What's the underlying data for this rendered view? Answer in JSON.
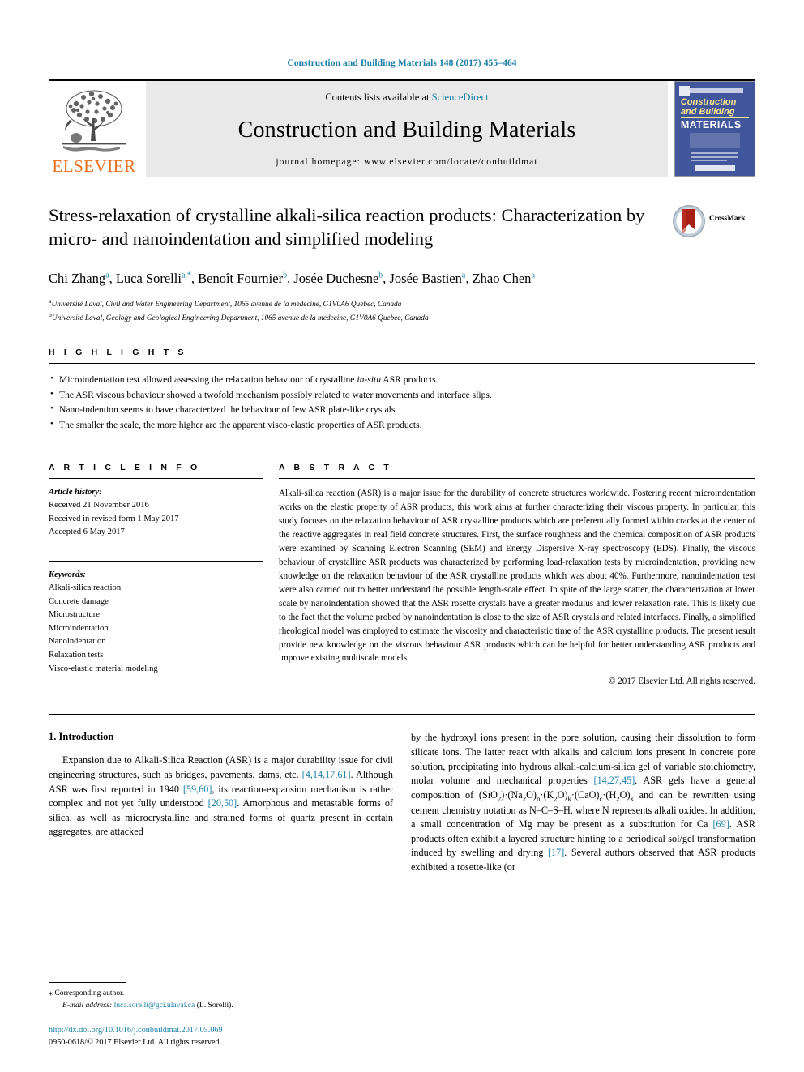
{
  "running_head": "Construction and Building Materials 148 (2017) 455–464",
  "masthead": {
    "publisher": "ELSEVIER",
    "contents_prefix": "Contents lists available at ",
    "contents_link": "ScienceDirect",
    "journal_title": "Construction and Building Materials",
    "homepage": "journal homepage: www.elsevier.com/locate/conbuildmat",
    "cover": {
      "line1": "Construction",
      "line2": "and Building",
      "line3": "MATERIALS"
    }
  },
  "article": {
    "title": "Stress-relaxation of crystalline alkali-silica reaction products: Characterization by micro- and nanoindentation and simplified modeling",
    "crossmark_label": "CrossMark",
    "authors": [
      {
        "name": "Chi Zhang",
        "sup": "a"
      },
      {
        "name": "Luca Sorelli",
        "sup": "a,*"
      },
      {
        "name": "Benoît Fournier",
        "sup": "b"
      },
      {
        "name": "Josée Duchesne",
        "sup": "b"
      },
      {
        "name": "Josée Bastien",
        "sup": "a"
      },
      {
        "name": "Zhao Chen",
        "sup": "a"
      }
    ],
    "affiliations": [
      {
        "sup": "a",
        "text": "Université Laval, Civil and Water Engineering Department, 1065 avenue de la medecine, G1V0A6 Quebec, Canada"
      },
      {
        "sup": "b",
        "text": "Université Laval, Geology and Geological Engineering Department, 1065 avenue de la medecine, G1V0A6 Quebec, Canada"
      }
    ]
  },
  "highlights": {
    "heading": "H I G H L I G H T S",
    "items": [
      "Microindentation test allowed assessing the relaxation behaviour of crystalline in-situ ASR products.",
      "The ASR viscous behaviour showed a twofold mechanism possibly related to water movements and interface slips.",
      "Nano-indention seems to have characterized the behaviour of few ASR plate-like crystals.",
      "The smaller the scale, the more higher are the apparent visco-elastic properties of ASR products."
    ]
  },
  "article_info": {
    "heading": "A R T I C L E    I N F O",
    "history_label": "Article history:",
    "history": [
      "Received 21 November 2016",
      "Received in revised form 1 May 2017",
      "Accepted 6 May 2017"
    ],
    "keywords_label": "Keywords:",
    "keywords": [
      "Alkali-silica reaction",
      "Concrete damage",
      "Microstructure",
      "Microindentation",
      "Nanoindentation",
      "Relaxation tests",
      "Visco-elastic material modeling"
    ]
  },
  "abstract": {
    "heading": "A B S T R A C T",
    "text": "Alkali-silica reaction (ASR) is a major issue for the durability of concrete structures worldwide. Fostering recent microindentation works on the elastic property of ASR products, this work aims at further characterizing their viscous property. In particular, this study focuses on the relaxation behaviour of ASR crystalline products which are preferentially formed within cracks at the center of the reactive aggregates in real field concrete structures. First, the surface roughness and the chemical composition of ASR products were examined by Scanning Electron Scanning (SEM) and Energy Dispersive X-ray spectroscopy (EDS). Finally, the viscous behaviour of crystalline ASR products was characterized by performing load-relaxation tests by microindentation, providing new knowledge on the relaxation behaviour of the ASR crystalline products which was about 40%. Furthermore, nanoindentation test were also carried out to better understand the possible length-scale effect. In spite of the large scatter, the characterization at lower scale by nanoindentation showed that the ASR rosette crystals have a greater modulus and lower relaxation rate. This is likely due to the fact that the volume probed by nanoindentation is close to the size of ASR crystals and related interfaces. Finally, a simplified rheological model was employed to estimate the viscosity and characteristic time of the ASR crystalline products. The present result provide new knowledge on the viscous behaviour ASR products which can be helpful for better understanding ASR products and improve existing multiscale models.",
    "copyright": "© 2017 Elsevier Ltd. All rights reserved."
  },
  "introduction": {
    "heading": "1. Introduction",
    "left_paragraph_parts": [
      "Expansion due to Alkali-Silica Reaction (ASR) is a major durability issue for civil engineering structures, such as bridges, pavements, dams, etc. ",
      "[4,14,17,61]",
      ". Although ASR was first reported in 1940 ",
      "[59,60]",
      ", its reaction-expansion mechanism is rather complex and not yet fully understood ",
      "[20,50]",
      ". Amorphous and metastable forms of silica, as well as microcrystalline and strained forms of quartz present in certain aggregates, are attacked"
    ],
    "right_paragraph_parts": [
      "by the hydroxyl ions present in the pore solution, causing their dissolution to form silicate ions. The latter react with alkalis and calcium ions present in concrete pore solution, precipitating into hydrous alkali-calcium-silica gel of variable stoichiometry, molar volume and mechanical properties ",
      "[14,27,45]",
      ". ASR gels have a general composition of (SiO2)·(Na2O)n·(K2O)k·(CaO)c·(H2O)x and can be rewritten using cement chemistry notation as N–C–S–H, where N represents alkali oxides. In addition, a small concentration of Mg may be present as a substitution for Ca ",
      "[69]",
      ". ASR products often exhibit a layered structure hinting to a periodical sol/gel transformation induced by swelling and drying ",
      "[17]",
      ". Several authors observed that ASR products exhibited a rosette-like (or"
    ]
  },
  "footer": {
    "corresponding_star": "⁎",
    "corresponding_label": "Corresponding author.",
    "email_label": "E-mail address:",
    "email": "luca.sorelli@gci.ulaval.ca",
    "email_suffix": "(L. Sorelli).",
    "doi": "http://dx.doi.org/10.1016/j.conbuildmat.2017.05.069",
    "issn_line": "0950-0618/© 2017 Elsevier Ltd. All rights reserved."
  },
  "colors": {
    "link": "#1a7fa8",
    "elsevier_orange": "#E9711C",
    "cover_blue": "#41569b"
  }
}
